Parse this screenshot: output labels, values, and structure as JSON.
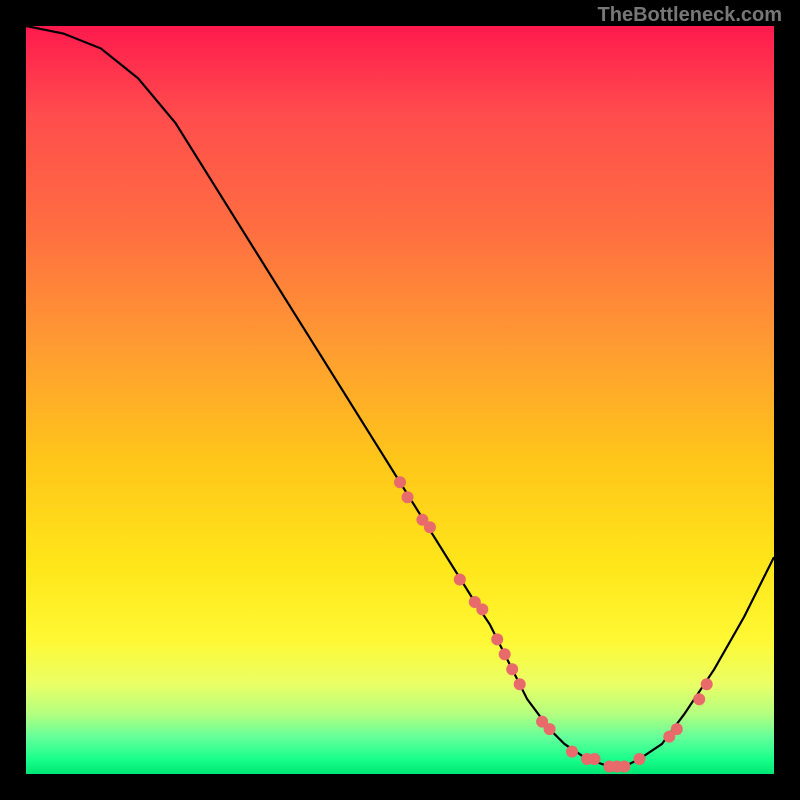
{
  "watermark": "TheBottleneck.com",
  "chart_data": {
    "type": "line",
    "title": "",
    "xlabel": "",
    "ylabel": "",
    "xlim": [
      0,
      100
    ],
    "ylim": [
      0,
      100
    ],
    "series": [
      {
        "name": "bottleneck-curve",
        "x": [
          0,
          5,
          10,
          15,
          20,
          25,
          30,
          35,
          40,
          45,
          50,
          55,
          60,
          62,
          65,
          67,
          70,
          72,
          75,
          78,
          80,
          82,
          85,
          88,
          92,
          96,
          100
        ],
        "values": [
          100,
          99,
          97,
          93,
          87,
          79,
          71,
          63,
          55,
          47,
          39,
          31,
          23,
          20,
          14,
          10,
          6,
          4,
          2,
          1,
          1,
          2,
          4,
          8,
          14,
          21,
          29
        ]
      }
    ],
    "markers": {
      "name": "data-points",
      "x": [
        50,
        51,
        53,
        54,
        58,
        60,
        61,
        63,
        64,
        65,
        66,
        69,
        70,
        73,
        75,
        76,
        78,
        79,
        80,
        82,
        86,
        87,
        90,
        91
      ],
      "values": [
        39,
        37,
        34,
        33,
        26,
        23,
        22,
        18,
        16,
        14,
        12,
        7,
        6,
        3,
        2,
        2,
        1,
        1,
        1,
        2,
        5,
        6,
        10,
        12
      ]
    }
  }
}
